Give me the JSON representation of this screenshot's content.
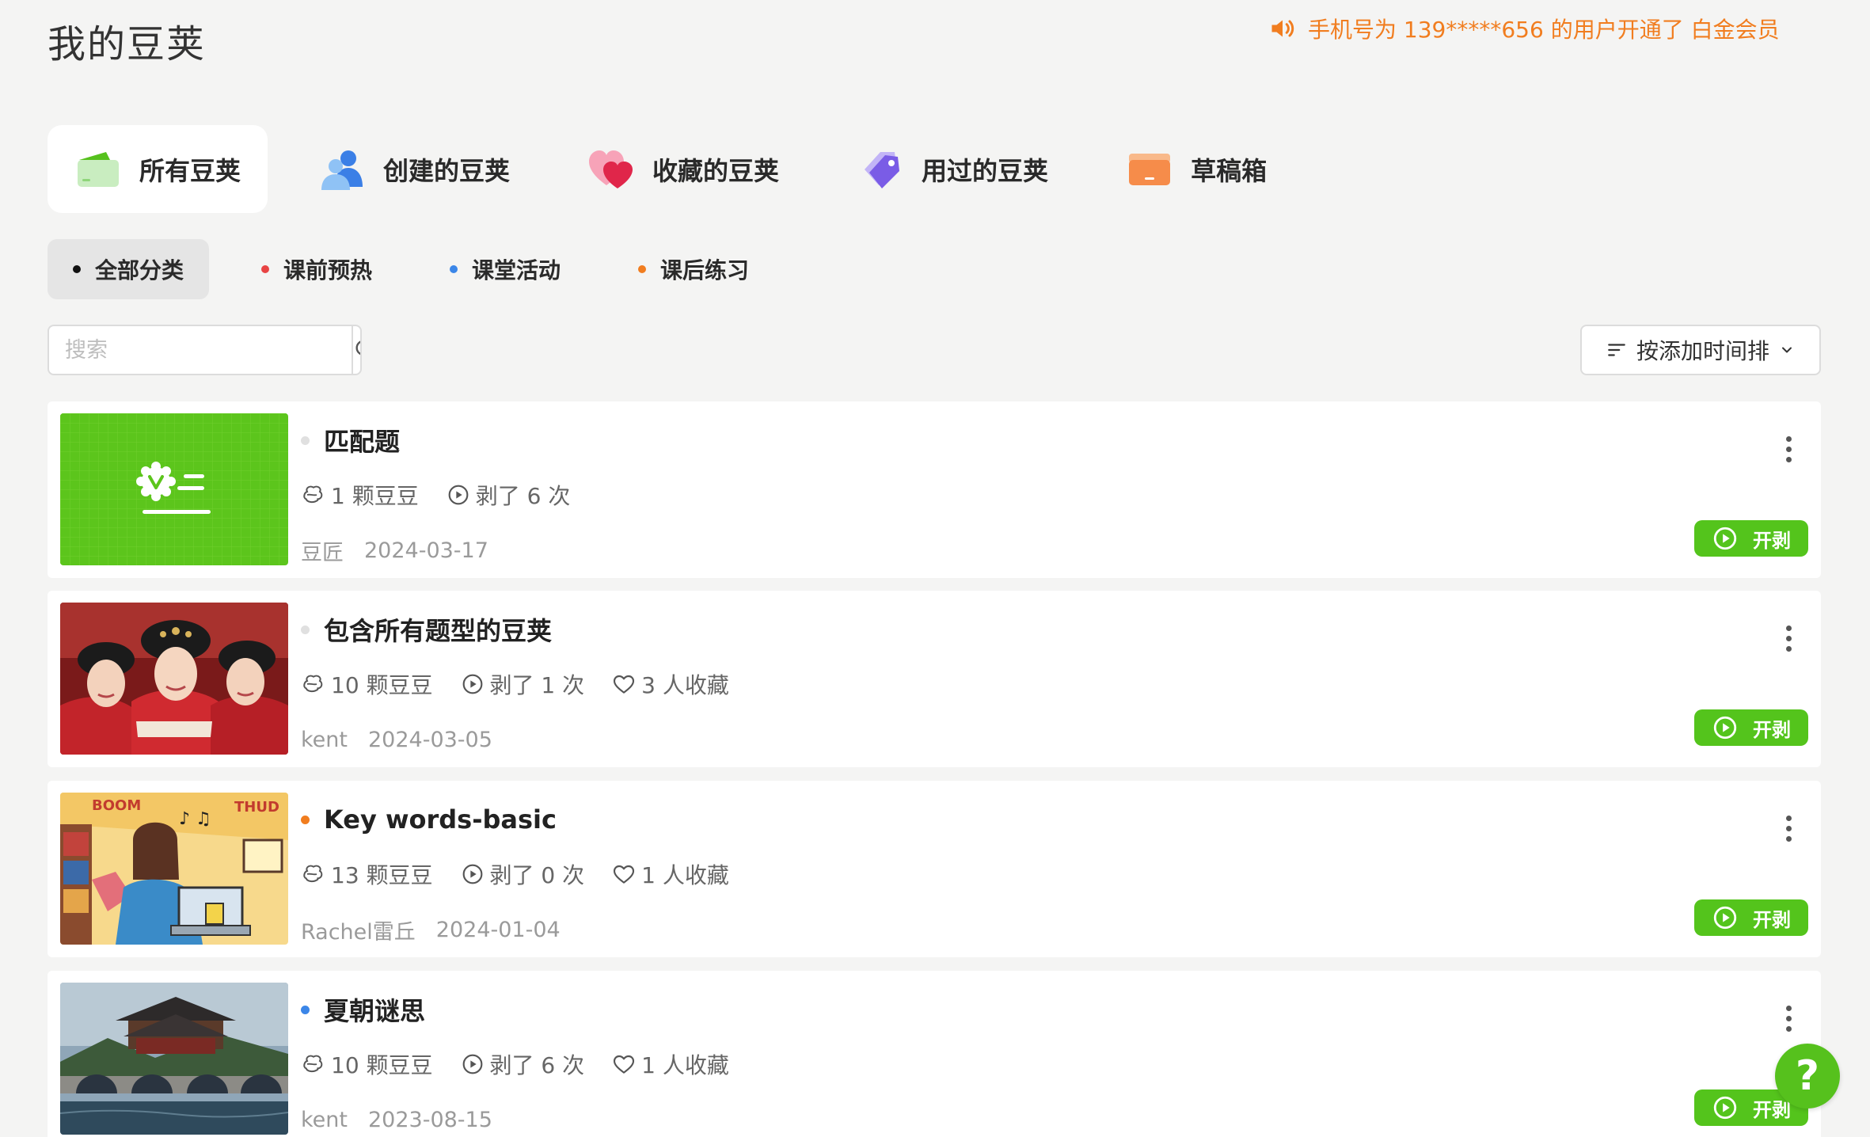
{
  "page": {
    "title": "我的豆荚"
  },
  "notice": {
    "text": "手机号为 139*****656 的用户开通了 白金会员",
    "color": "#f17d1f"
  },
  "tabs": [
    {
      "label": "所有豆荚",
      "icon": "wallet-icon",
      "active": true
    },
    {
      "label": "创建的豆荚",
      "icon": "user-group-icon",
      "active": false
    },
    {
      "label": "收藏的豆荚",
      "icon": "heart-icon",
      "active": false
    },
    {
      "label": "用过的豆荚",
      "icon": "tag-icon",
      "active": false
    },
    {
      "label": "草稿箱",
      "icon": "drawer-icon",
      "active": false
    }
  ],
  "categories": [
    {
      "label": "全部分类",
      "dot_color": "#111111",
      "active": true
    },
    {
      "label": "课前预热",
      "dot_color": "#e84343",
      "active": false
    },
    {
      "label": "课堂活动",
      "dot_color": "#3b86e8",
      "active": false
    },
    {
      "label": "课后练习",
      "dot_color": "#f17d1f",
      "active": false
    }
  ],
  "search": {
    "placeholder": "搜索",
    "value": ""
  },
  "sort": {
    "label": "按添加时间排"
  },
  "play_label": "开剥",
  "items": [
    {
      "title": "匹配题",
      "dot_color": "#e0e0e0",
      "beans": "1 颗豆豆",
      "plays": "剥了 6 次",
      "favorites": "",
      "author": "豆匠",
      "date": "2024-03-17",
      "thumb": "match-quiz-thumbnail"
    },
    {
      "title": "包含所有题型的豆荚",
      "dot_color": "#e0e0e0",
      "beans": "10 颗豆豆",
      "plays": "剥了 1 次",
      "favorites": "3 人收藏",
      "author": "kent",
      "date": "2024-03-05",
      "thumb": "costume-women-photo"
    },
    {
      "title": "Key words-basic",
      "dot_color": "#f17d1f",
      "beans": "13 颗豆豆",
      "plays": "剥了 0 次",
      "favorites": "1 人收藏",
      "author": "Rachel雷丘",
      "date": "2024-01-04",
      "thumb": "comic-girl-illustration"
    },
    {
      "title": "夏朝谜思",
      "dot_color": "#3b86e8",
      "beans": "10 颗豆豆",
      "plays": "剥了 6 次",
      "favorites": "1 人收藏",
      "author": "kent",
      "date": "2023-08-15",
      "thumb": "ancient-pavilion-bridge-photo"
    }
  ],
  "help": {
    "label": "?"
  }
}
